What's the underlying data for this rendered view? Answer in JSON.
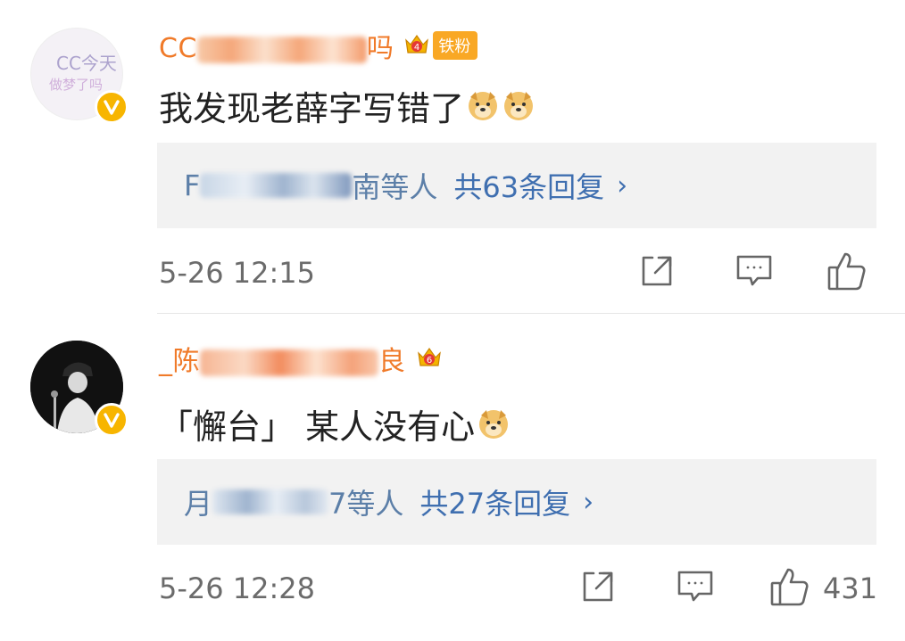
{
  "comments": [
    {
      "username_visible_start": "CC",
      "username_visible_end": "吗",
      "fan_badge_label": "铁粉",
      "crown_level": "4",
      "avatar_text_line1": "CC今天",
      "avatar_text_line2": "做梦了吗",
      "text": "我发现老薛字写错了",
      "reply_names_start": "F",
      "reply_names_end": "南等人",
      "reply_count_label": "共63条回复",
      "reply_chevron": "›",
      "timestamp": "5-26 12:15",
      "like_count": ""
    },
    {
      "username_visible_start": "_陈",
      "username_visible_end": "良",
      "crown_level": "6",
      "text": "「懈台」 某人没有心",
      "reply_names_start": "月",
      "reply_names_end": "7等人",
      "reply_count_label": "共27条回复",
      "reply_chevron": "›",
      "timestamp": "5-26 12:28",
      "like_count": "431"
    }
  ],
  "icons": {
    "share": "share-icon",
    "comment": "comment-icon",
    "like": "thumbs-up-icon",
    "verified": "verified-badge-icon",
    "crown": "crown-icon",
    "emoji": "doge-emoji-icon"
  },
  "colors": {
    "username": "#f07a29",
    "reply_link": "#3f6fb0",
    "reply_names": "#5c7fa8",
    "verified_badge": "#f7b500",
    "reply_box_bg": "#f2f2f2",
    "timestamp": "#6b6b6b"
  }
}
